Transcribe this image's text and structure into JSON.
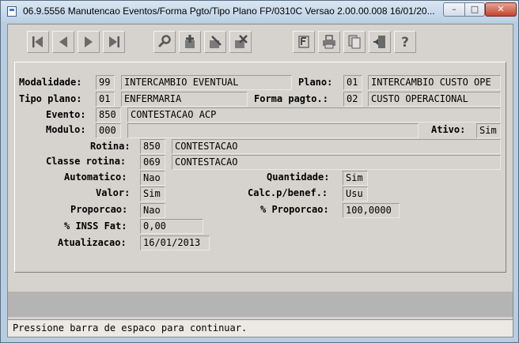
{
  "window": {
    "title": "06.9.5556 Manutencao  Eventos/Forma Pgto/Tipo Plano FP/0310C Versao 2.00.00.008 16/01/20...",
    "minimize_glyph": "–",
    "maximize_glyph": "□",
    "close_glyph": "✕"
  },
  "toolbar": {
    "icons": [
      "first-record-icon",
      "previous-record-icon",
      "next-record-icon",
      "last-record-icon",
      "search-key-icon",
      "add-record-icon",
      "edit-record-icon",
      "delete-record-icon",
      "filter-icon",
      "print-icon",
      "copy-icon",
      "exit-door-icon",
      "help-icon"
    ]
  },
  "form": {
    "modalidade": {
      "label": "Modalidade:",
      "code": "99",
      "desc": "INTERCAMBIO EVENTUAL"
    },
    "plano": {
      "label": "Plano:",
      "code": "01",
      "desc": "INTERCAMBIO CUSTO OPE"
    },
    "tipo_plano": {
      "label": "Tipo plano:",
      "code": "01",
      "desc": "ENFERMARIA"
    },
    "forma_pagto": {
      "label": "Forma pagto.:",
      "code": "02",
      "desc": "CUSTO OPERACIONAL"
    },
    "evento": {
      "label": "Evento:",
      "code": "850",
      "desc": "CONTESTACAO ACP"
    },
    "modulo": {
      "label": "Modulo:",
      "code": "000",
      "desc": ""
    },
    "ativo": {
      "label": "Ativo:",
      "value": "Sim"
    },
    "rotina": {
      "label": "Rotina:",
      "code": "850",
      "desc": "CONTESTACAO"
    },
    "classe_rotina": {
      "label": "Classe rotina:",
      "code": "069",
      "desc": "CONTESTACAO"
    },
    "automatico": {
      "label": "Automatico:",
      "value": "Nao"
    },
    "quantidade": {
      "label": "Quantidade:",
      "value": "Sim"
    },
    "valor": {
      "label": "Valor:",
      "value": "Sim"
    },
    "calc_benef": {
      "label": "Calc.p/benef.:",
      "value": "Usu"
    },
    "proporcao": {
      "label": "Proporcao:",
      "value": "Nao"
    },
    "pct_proporcao": {
      "label": "% Proporcao:",
      "value": "100,0000"
    },
    "pct_inss_fat": {
      "label": "% INSS Fat:",
      "value": "0,00"
    },
    "atualizacao": {
      "label": "Atualizacao:",
      "value": "16/01/2013"
    }
  },
  "status": {
    "message": "Pressione barra de espaco para continuar."
  }
}
